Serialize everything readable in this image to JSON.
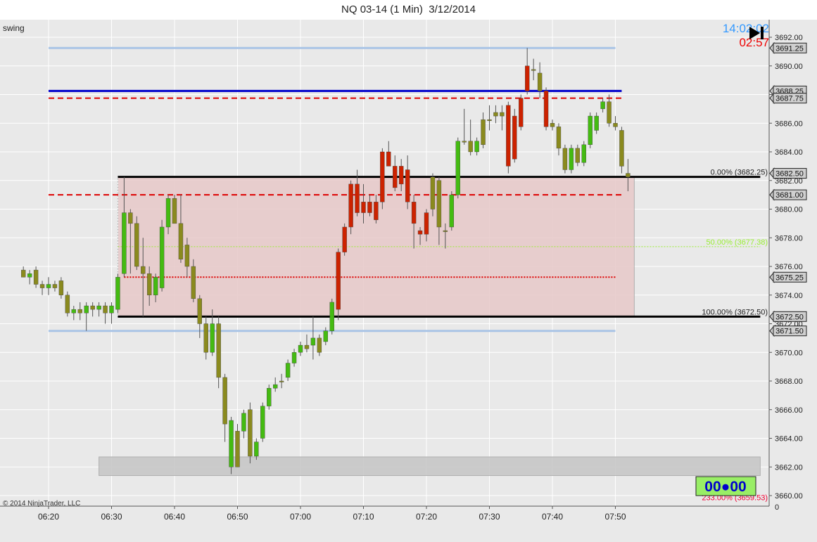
{
  "window": {
    "title": "NQ 03-14 (1 Min)  3/12/2014"
  },
  "panel": {
    "label": "swing",
    "copyright": "© 2014 NinjaTrader, LLC",
    "clock": "14:02:02",
    "countdown": "02:57",
    "timer_badge": "00●00"
  },
  "colors": {
    "background": "#e9e9e9",
    "grid": "#ffffff",
    "up_candle": "#44bb11",
    "down_candle_olive": "#8a8a1e",
    "down_candle_red": "#cc2200",
    "swing_high_line": "#0000cc",
    "fib_line": "#000000",
    "red_dashed": "#dd0000",
    "light_blue_line": "#a9c4e6",
    "clock_blue": "#3399ff",
    "countdown_red": "#ee0000",
    "badge_bg": "#99ee66",
    "badge_text": "#0000cc"
  },
  "chart_data": {
    "type": "candlestick",
    "instrument": "NQ 03-14",
    "interval": "1 Min",
    "date": "3/12/2014",
    "ylim": [
      3659.2,
      3693.6
    ],
    "y_ticks": [
      "3692.00",
      "3690.00",
      "3688.00",
      "3686.00",
      "3684.00",
      "3682.00",
      "3680.00",
      "3678.00",
      "3676.00",
      "3674.00",
      "3672.00",
      "3670.00",
      "3668.00",
      "3666.00",
      "3664.00",
      "3662.00",
      "3660.00"
    ],
    "y_tick_values": [
      3692,
      3690,
      3688,
      3686,
      3684,
      3682,
      3680,
      3678,
      3676,
      3674,
      3672,
      3670,
      3668,
      3666,
      3664,
      3662,
      3660
    ],
    "y_axis_bottom_label": "0",
    "x_ticks": [
      "06:20",
      "06:30",
      "06:40",
      "06:50",
      "07:00",
      "07:10",
      "07:20",
      "07:30",
      "07:40",
      "07:50"
    ],
    "x_tick_values": [
      380,
      390,
      400,
      410,
      420,
      430,
      440,
      450,
      460,
      470
    ],
    "price_badges": [
      {
        "label": "3691.25",
        "value": 3691.25
      },
      {
        "label": "3688.25",
        "value": 3688.25
      },
      {
        "label": "3687.75",
        "value": 3687.75
      },
      {
        "label": "3682.50",
        "value": 3682.5
      },
      {
        "label": "3681.00",
        "value": 3681.0
      },
      {
        "label": "3675.25",
        "value": 3675.25
      },
      {
        "label": "3672.50",
        "value": 3672.5
      },
      {
        "label": "3671.50",
        "value": 3671.5
      }
    ],
    "horizontal_lines": [
      {
        "name": "light-blue-top",
        "value": 3691.25,
        "from": 380,
        "to": 470,
        "style": "solid",
        "color": "#a9c4e6",
        "width": 3
      },
      {
        "name": "blue-swing-high",
        "value": 3688.25,
        "from": 380,
        "to": 471,
        "style": "solid",
        "color": "#0000cc",
        "width": 3
      },
      {
        "name": "red-dashed-upper",
        "value": 3687.75,
        "from": 380,
        "to": 471,
        "style": "dashed",
        "color": "#dd0000",
        "width": 2
      },
      {
        "name": "fib-0",
        "value": 3682.25,
        "from": 391,
        "to": 493,
        "style": "solid",
        "color": "#000000",
        "width": 3
      },
      {
        "name": "red-dashed-lower",
        "value": 3681.0,
        "from": 380,
        "to": 471,
        "style": "dashed",
        "color": "#dd0000",
        "width": 2
      },
      {
        "name": "fib-50",
        "value": 3677.38,
        "from": 391,
        "to": 493,
        "style": "dotted",
        "color": "#99ee33",
        "width": 1
      },
      {
        "name": "red-dotted",
        "value": 3675.25,
        "from": 392,
        "to": 470,
        "style": "dotted",
        "color": "#dd0000",
        "width": 2
      },
      {
        "name": "fib-100",
        "value": 3672.5,
        "from": 391,
        "to": 493,
        "style": "solid",
        "color": "#000000",
        "width": 3
      },
      {
        "name": "light-blue-bottom",
        "value": 3671.5,
        "from": 380,
        "to": 470,
        "style": "solid",
        "color": "#a9c4e6",
        "width": 3
      }
    ],
    "fib_labels": [
      {
        "text": "0.00% (3682.25)",
        "value": 3682.25,
        "color": "#222222"
      },
      {
        "text": "50.00% (3677.38)",
        "value": 3677.38,
        "color": "#99ee33"
      },
      {
        "text": "100.00% (3672.50)",
        "value": 3672.5,
        "color": "#222222"
      },
      {
        "text": "233.00% (3659.53)",
        "value": 3659.53,
        "color": "#ee0033"
      }
    ],
    "zones": [
      {
        "name": "fib-zone",
        "x_from": 391,
        "x_to": 473,
        "y_top": 3682.25,
        "y_bottom": 3672.5,
        "color": "#e6c8c8"
      },
      {
        "name": "projection-zone",
        "x_from": 388,
        "x_to": 493,
        "y_top": 3662.7,
        "y_bottom": 3661.4,
        "color": "#c4c4c4"
      }
    ],
    "candles": [
      {
        "t": 376,
        "o": 3675.75,
        "h": 3676.0,
        "l": 3675.25,
        "c": 3675.25,
        "col": "olive"
      },
      {
        "t": 377,
        "o": 3675.25,
        "h": 3675.75,
        "l": 3674.75,
        "c": 3675.5,
        "col": "green"
      },
      {
        "t": 378,
        "o": 3675.75,
        "h": 3676.0,
        "l": 3674.5,
        "c": 3674.75,
        "col": "olive"
      },
      {
        "t": 379,
        "o": 3674.75,
        "h": 3675.0,
        "l": 3674.0,
        "c": 3674.5,
        "col": "olive"
      },
      {
        "t": 380,
        "o": 3674.5,
        "h": 3675.25,
        "l": 3674.0,
        "c": 3674.75,
        "col": "green"
      },
      {
        "t": 381,
        "o": 3674.75,
        "h": 3675.0,
        "l": 3674.25,
        "c": 3674.5,
        "col": "olive"
      },
      {
        "t": 382,
        "o": 3675.0,
        "h": 3675.25,
        "l": 3673.75,
        "c": 3674.0,
        "col": "olive"
      },
      {
        "t": 383,
        "o": 3674.0,
        "h": 3674.25,
        "l": 3672.5,
        "c": 3672.75,
        "col": "olive"
      },
      {
        "t": 384,
        "o": 3672.75,
        "h": 3673.25,
        "l": 3672.25,
        "c": 3673.0,
        "col": "green"
      },
      {
        "t": 385,
        "o": 3673.0,
        "h": 3673.5,
        "l": 3672.25,
        "c": 3672.75,
        "col": "olive"
      },
      {
        "t": 386,
        "o": 3672.75,
        "h": 3673.5,
        "l": 3671.5,
        "c": 3673.25,
        "col": "green"
      },
      {
        "t": 387,
        "o": 3673.25,
        "h": 3673.5,
        "l": 3672.5,
        "c": 3673.0,
        "col": "olive"
      },
      {
        "t": 388,
        "o": 3673.0,
        "h": 3673.5,
        "l": 3672.5,
        "c": 3673.25,
        "col": "green"
      },
      {
        "t": 389,
        "o": 3673.25,
        "h": 3673.5,
        "l": 3672.0,
        "c": 3672.75,
        "col": "olive"
      },
      {
        "t": 390,
        "o": 3672.75,
        "h": 3673.5,
        "l": 3672.0,
        "c": 3673.25,
        "col": "green"
      },
      {
        "t": 391,
        "o": 3673.0,
        "h": 3675.5,
        "l": 3672.75,
        "c": 3675.25,
        "col": "green"
      },
      {
        "t": 392,
        "o": 3675.5,
        "h": 3682.25,
        "l": 3675.25,
        "c": 3679.75,
        "col": "green"
      },
      {
        "t": 393,
        "o": 3679.75,
        "h": 3680.0,
        "l": 3675.5,
        "c": 3679.0,
        "col": "olive"
      },
      {
        "t": 394,
        "o": 3679.0,
        "h": 3679.5,
        "l": 3675.75,
        "c": 3676.0,
        "col": "olive"
      },
      {
        "t": 395,
        "o": 3676.0,
        "h": 3678.0,
        "l": 3672.5,
        "c": 3675.5,
        "col": "olive"
      },
      {
        "t": 396,
        "o": 3675.5,
        "h": 3676.0,
        "l": 3673.25,
        "c": 3674.0,
        "col": "olive"
      },
      {
        "t": 397,
        "o": 3674.0,
        "h": 3675.5,
        "l": 3673.5,
        "c": 3675.25,
        "col": "green"
      },
      {
        "t": 398,
        "o": 3674.5,
        "h": 3679.25,
        "l": 3674.25,
        "c": 3678.75,
        "col": "green"
      },
      {
        "t": 399,
        "o": 3678.75,
        "h": 3681.0,
        "l": 3678.25,
        "c": 3680.75,
        "col": "green"
      },
      {
        "t": 400,
        "o": 3680.75,
        "h": 3681.0,
        "l": 3679.0,
        "c": 3679.0,
        "col": "olive"
      },
      {
        "t": 401,
        "o": 3679.0,
        "h": 3681.0,
        "l": 3676.25,
        "c": 3676.5,
        "col": "olive"
      },
      {
        "t": 402,
        "o": 3677.5,
        "h": 3678.0,
        "l": 3675.25,
        "c": 3676.0,
        "col": "olive"
      },
      {
        "t": 403,
        "o": 3676.0,
        "h": 3676.5,
        "l": 3673.5,
        "c": 3673.75,
        "col": "olive"
      },
      {
        "t": 404,
        "o": 3673.75,
        "h": 3674.0,
        "l": 3671.0,
        "c": 3672.0,
        "col": "olive"
      },
      {
        "t": 405,
        "o": 3672.0,
        "h": 3672.5,
        "l": 3669.5,
        "c": 3670.0,
        "col": "olive"
      },
      {
        "t": 406,
        "o": 3670.0,
        "h": 3673.0,
        "l": 3669.75,
        "c": 3672.0,
        "col": "green"
      },
      {
        "t": 407,
        "o": 3672.0,
        "h": 3672.5,
        "l": 3667.5,
        "c": 3668.25,
        "col": "olive"
      },
      {
        "t": 408,
        "o": 3668.25,
        "h": 3668.5,
        "l": 3663.75,
        "c": 3665.0,
        "col": "olive"
      },
      {
        "t": 409,
        "o": 3662.0,
        "h": 3665.5,
        "l": 3661.5,
        "c": 3665.25,
        "col": "green"
      },
      {
        "t": 410,
        "o": 3664.5,
        "h": 3665.0,
        "l": 3662.0,
        "c": 3662.0,
        "col": "olive"
      },
      {
        "t": 411,
        "o": 3664.5,
        "h": 3666.0,
        "l": 3664.0,
        "c": 3665.75,
        "col": "green"
      },
      {
        "t": 412,
        "o": 3666.0,
        "h": 3666.5,
        "l": 3662.25,
        "c": 3662.75,
        "col": "olive"
      },
      {
        "t": 413,
        "o": 3662.75,
        "h": 3664.0,
        "l": 3662.5,
        "c": 3663.75,
        "col": "green"
      },
      {
        "t": 414,
        "o": 3664.0,
        "h": 3666.5,
        "l": 3663.75,
        "c": 3666.25,
        "col": "green"
      },
      {
        "t": 415,
        "o": 3666.25,
        "h": 3667.75,
        "l": 3666.0,
        "c": 3667.5,
        "col": "green"
      },
      {
        "t": 416,
        "o": 3667.5,
        "h": 3668.25,
        "l": 3667.25,
        "c": 3667.75,
        "col": "green"
      },
      {
        "t": 417,
        "o": 3668.0,
        "h": 3668.5,
        "l": 3667.5,
        "c": 3668.0,
        "col": "olive"
      },
      {
        "t": 418,
        "o": 3668.25,
        "h": 3669.5,
        "l": 3668.0,
        "c": 3669.25,
        "col": "green"
      },
      {
        "t": 419,
        "o": 3669.25,
        "h": 3670.25,
        "l": 3669.0,
        "c": 3670.0,
        "col": "green"
      },
      {
        "t": 420,
        "o": 3670.0,
        "h": 3670.75,
        "l": 3669.75,
        "c": 3670.5,
        "col": "green"
      },
      {
        "t": 421,
        "o": 3670.5,
        "h": 3671.25,
        "l": 3670.0,
        "c": 3670.25,
        "col": "olive"
      },
      {
        "t": 422,
        "o": 3670.5,
        "h": 3672.5,
        "l": 3669.5,
        "c": 3671.0,
        "col": "green"
      },
      {
        "t": 423,
        "o": 3671.0,
        "h": 3671.25,
        "l": 3669.75,
        "c": 3670.0,
        "col": "olive"
      },
      {
        "t": 424,
        "o": 3670.75,
        "h": 3671.75,
        "l": 3670.5,
        "c": 3671.5,
        "col": "green"
      },
      {
        "t": 425,
        "o": 3671.5,
        "h": 3673.75,
        "l": 3671.25,
        "c": 3673.5,
        "col": "green"
      },
      {
        "t": 426,
        "o": 3673.0,
        "h": 3677.25,
        "l": 3672.25,
        "c": 3677.0,
        "col": "red"
      },
      {
        "t": 427,
        "o": 3677.0,
        "h": 3679.0,
        "l": 3676.75,
        "c": 3678.75,
        "col": "red"
      },
      {
        "t": 428,
        "o": 3678.75,
        "h": 3682.0,
        "l": 3678.25,
        "c": 3681.75,
        "col": "red"
      },
      {
        "t": 429,
        "o": 3681.75,
        "h": 3682.75,
        "l": 3679.5,
        "c": 3679.75,
        "col": "red"
      },
      {
        "t": 430,
        "o": 3679.75,
        "h": 3681.75,
        "l": 3679.0,
        "c": 3680.5,
        "col": "red"
      },
      {
        "t": 431,
        "o": 3680.5,
        "h": 3681.0,
        "l": 3679.5,
        "c": 3679.75,
        "col": "red"
      },
      {
        "t": 432,
        "o": 3680.5,
        "h": 3681.0,
        "l": 3679.0,
        "c": 3679.25,
        "col": "red"
      },
      {
        "t": 433,
        "o": 3680.5,
        "h": 3684.25,
        "l": 3680.0,
        "c": 3684.0,
        "col": "red"
      },
      {
        "t": 434,
        "o": 3684.0,
        "h": 3684.75,
        "l": 3683.0,
        "c": 3683.0,
        "col": "red"
      },
      {
        "t": 435,
        "o": 3683.0,
        "h": 3683.75,
        "l": 3681.25,
        "c": 3681.5,
        "col": "red"
      },
      {
        "t": 436,
        "o": 3683.0,
        "h": 3683.5,
        "l": 3681.25,
        "c": 3681.75,
        "col": "red"
      },
      {
        "t": 437,
        "o": 3682.75,
        "h": 3683.75,
        "l": 3680.0,
        "c": 3680.5,
        "col": "red"
      },
      {
        "t": 438,
        "o": 3680.5,
        "h": 3681.0,
        "l": 3677.25,
        "c": 3679.0,
        "col": "red"
      },
      {
        "t": 439,
        "o": 3678.5,
        "h": 3678.75,
        "l": 3677.5,
        "c": 3678.25,
        "col": "red"
      },
      {
        "t": 440,
        "o": 3678.25,
        "h": 3680.0,
        "l": 3677.75,
        "c": 3679.75,
        "col": "red"
      },
      {
        "t": 441,
        "o": 3680.0,
        "h": 3682.5,
        "l": 3679.5,
        "c": 3682.25,
        "col": "olive"
      },
      {
        "t": 442,
        "o": 3682.0,
        "h": 3682.25,
        "l": 3677.5,
        "c": 3678.75,
        "col": "olive"
      },
      {
        "t": 443,
        "o": 3678.5,
        "h": 3679.0,
        "l": 3677.25,
        "c": 3678.5,
        "col": "olive"
      },
      {
        "t": 444,
        "o": 3678.75,
        "h": 3681.25,
        "l": 3678.5,
        "c": 3681.0,
        "col": "green"
      },
      {
        "t": 445,
        "o": 3681.0,
        "h": 3685.0,
        "l": 3680.75,
        "c": 3684.75,
        "col": "green"
      },
      {
        "t": 446,
        "o": 3684.75,
        "h": 3687.0,
        "l": 3684.5,
        "c": 3684.75,
        "col": "olive"
      },
      {
        "t": 447,
        "o": 3684.75,
        "h": 3686.25,
        "l": 3683.75,
        "c": 3684.0,
        "col": "olive"
      },
      {
        "t": 448,
        "o": 3684.0,
        "h": 3685.0,
        "l": 3683.75,
        "c": 3684.75,
        "col": "green"
      },
      {
        "t": 449,
        "o": 3684.5,
        "h": 3686.75,
        "l": 3684.25,
        "c": 3686.25,
        "col": "olive"
      },
      {
        "t": 450,
        "o": 3686.25,
        "h": 3687.25,
        "l": 3685.5,
        "c": 3686.25,
        "col": "olive"
      },
      {
        "t": 451,
        "o": 3686.75,
        "h": 3687.25,
        "l": 3686.0,
        "c": 3686.5,
        "col": "olive"
      },
      {
        "t": 452,
        "o": 3686.75,
        "h": 3687.25,
        "l": 3685.5,
        "c": 3686.5,
        "col": "olive"
      },
      {
        "t": 453,
        "o": 3687.25,
        "h": 3687.5,
        "l": 3682.5,
        "c": 3683.0,
        "col": "red"
      },
      {
        "t": 454,
        "o": 3683.5,
        "h": 3687.0,
        "l": 3683.25,
        "c": 3686.5,
        "col": "red"
      },
      {
        "t": 455,
        "o": 3685.75,
        "h": 3688.0,
        "l": 3685.5,
        "c": 3687.75,
        "col": "red"
      },
      {
        "t": 456,
        "o": 3688.25,
        "h": 3691.25,
        "l": 3688.0,
        "c": 3690.0,
        "col": "red"
      },
      {
        "t": 457,
        "o": 3689.75,
        "h": 3690.5,
        "l": 3689.0,
        "c": 3689.75,
        "col": "olive"
      },
      {
        "t": 458,
        "o": 3689.5,
        "h": 3690.25,
        "l": 3687.75,
        "c": 3688.25,
        "col": "olive"
      },
      {
        "t": 459,
        "o": 3688.25,
        "h": 3688.5,
        "l": 3685.5,
        "c": 3685.75,
        "col": "red"
      },
      {
        "t": 460,
        "o": 3686.0,
        "h": 3686.25,
        "l": 3685.5,
        "c": 3685.75,
        "col": "olive"
      },
      {
        "t": 461,
        "o": 3685.75,
        "h": 3686.0,
        "l": 3683.75,
        "c": 3684.25,
        "col": "olive"
      },
      {
        "t": 462,
        "o": 3684.25,
        "h": 3684.5,
        "l": 3682.5,
        "c": 3682.75,
        "col": "olive"
      },
      {
        "t": 463,
        "o": 3682.75,
        "h": 3684.5,
        "l": 3682.5,
        "c": 3684.25,
        "col": "green"
      },
      {
        "t": 464,
        "o": 3684.25,
        "h": 3684.5,
        "l": 3683.0,
        "c": 3683.25,
        "col": "olive"
      },
      {
        "t": 465,
        "o": 3683.25,
        "h": 3684.75,
        "l": 3683.0,
        "c": 3684.5,
        "col": "green"
      },
      {
        "t": 466,
        "o": 3684.5,
        "h": 3686.75,
        "l": 3684.25,
        "c": 3686.5,
        "col": "green"
      },
      {
        "t": 467,
        "o": 3685.5,
        "h": 3686.75,
        "l": 3685.25,
        "c": 3686.5,
        "col": "green"
      },
      {
        "t": 468,
        "o": 3687.5,
        "h": 3687.75,
        "l": 3686.75,
        "c": 3687.0,
        "col": "green"
      },
      {
        "t": 469,
        "o": 3687.5,
        "h": 3688.0,
        "l": 3685.75,
        "c": 3686.0,
        "col": "olive"
      },
      {
        "t": 470,
        "o": 3686.0,
        "h": 3686.5,
        "l": 3685.5,
        "c": 3685.75,
        "col": "olive"
      },
      {
        "t": 471,
        "o": 3685.5,
        "h": 3685.75,
        "l": 3682.5,
        "c": 3683.0,
        "col": "olive"
      },
      {
        "t": 472,
        "o": 3682.5,
        "h": 3683.5,
        "l": 3681.25,
        "c": 3682.25,
        "col": "olive"
      }
    ]
  }
}
